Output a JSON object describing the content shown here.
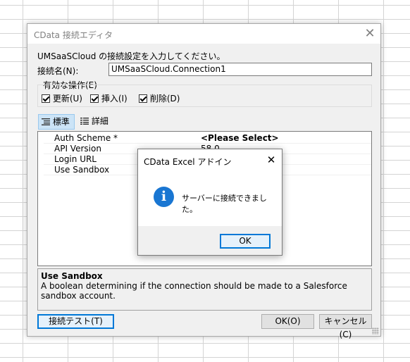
{
  "dialog": {
    "title": "CData 接続エディタ",
    "close_glyph": "✕",
    "instruction": "UMSaaSCloud の接続設定を入力してください。",
    "name_label": "接続名(N):",
    "name_value": "UMSaaSCloud.Connection1",
    "operations_legend": "有効な操作(E)",
    "operations": [
      {
        "label": "更新(U)",
        "checked": true
      },
      {
        "label": "挿入(I)",
        "checked": true
      },
      {
        "label": "削除(D)",
        "checked": true
      }
    ],
    "tabs": [
      {
        "label": "標準",
        "icon": "list-icon",
        "active": true
      },
      {
        "label": "詳細",
        "icon": "detail-list-icon",
        "active": false
      }
    ],
    "properties": [
      {
        "name": "Auth Scheme *",
        "value": "<Please Select>",
        "bold": true
      },
      {
        "name": "API Version",
        "value": "58.0",
        "bold": false
      },
      {
        "name": "Login URL",
        "value": "",
        "bold": false
      },
      {
        "name": "Use Sandbox",
        "value": "",
        "bold": false
      }
    ],
    "description": {
      "title": "Use Sandbox",
      "text": "A boolean determining if the connection should be made to a Salesforce sandbox account."
    },
    "buttons": {
      "test": "接続テスト(T)",
      "ok": "OK(O)",
      "cancel": "キャンセル(C)"
    }
  },
  "message_box": {
    "title": "CData Excel アドイン",
    "close_glyph": "✕",
    "icon_glyph": "i",
    "message": "サーバーに接続できました。",
    "ok_label": "OK"
  }
}
